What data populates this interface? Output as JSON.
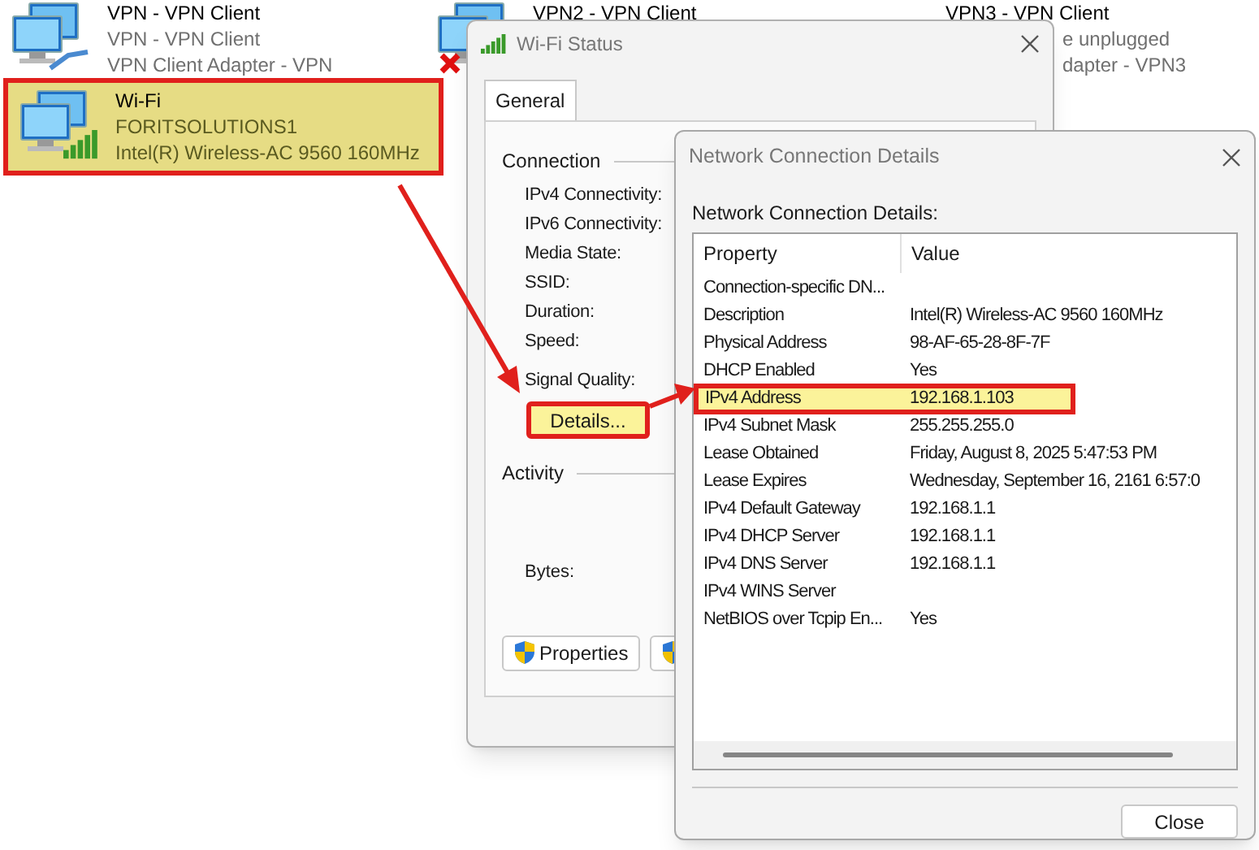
{
  "explorer_items": [
    {
      "name": "VPN - VPN Client",
      "line_2": "VPN - VPN Client",
      "line_3": "VPN Client Adapter - VPN",
      "kind": "vpn",
      "selected": false
    },
    {
      "name": "VPN2 - VPN Client",
      "kind": "vpn",
      "disconnected": true,
      "selected": false
    },
    {
      "name": "VPN3 - VPN Client",
      "line_2": "e unplugged",
      "line_3": "dapter - VPN3",
      "kind": "covered",
      "selected": false
    },
    {
      "name": "Wi-Fi",
      "line_2": "FORITSOLUTIONS1",
      "line_3": "Intel(R) Wireless-AC 9560 160MHz",
      "kind": "wifi",
      "selected": true
    }
  ],
  "status_window": {
    "title": "Wi-Fi Status",
    "tabs": [
      {
        "label": "General",
        "selected": true
      }
    ],
    "connection": {
      "title": "Connection",
      "fields": [
        "IPv4 Connectivity:",
        "IPv6 Connectivity:",
        "Media State:",
        "SSID:",
        "Duration:",
        "Speed:"
      ]
    },
    "signal_quality_label": "Signal Quality:",
    "details_button": {
      "label": "Details...",
      "highlighted": true
    },
    "activity": {
      "title": "Activity",
      "bytes_label": "Bytes:"
    },
    "properties_button": {
      "label": "Properties"
    }
  },
  "details_window": {
    "title": "Network Connection Details",
    "caption": "Network Connection Details:",
    "columns": [
      "Property",
      "Value"
    ],
    "rows": [
      {
        "property": "Connection-specific DN...",
        "value": "",
        "selected": false
      },
      {
        "property": "Description",
        "value": "Intel(R) Wireless-AC 9560 160MHz",
        "selected": false
      },
      {
        "property": "Physical Address",
        "value": "98-AF-65-28-8F-7F",
        "selected": false
      },
      {
        "property": "DHCP Enabled",
        "value": "Yes",
        "selected": false
      },
      {
        "property": "IPv4 Address",
        "value": "192.168.1.103",
        "selected": true
      },
      {
        "property": "IPv4 Subnet Mask",
        "value": "255.255.255.0",
        "selected": false
      },
      {
        "property": "Lease Obtained",
        "value": "Friday, August 8, 2025 5:47:53 PM",
        "selected": false
      },
      {
        "property": "Lease Expires",
        "value": "Wednesday, September 16, 2161 6:57:0",
        "selected": false
      },
      {
        "property": "IPv4 Default Gateway",
        "value": "192.168.1.1",
        "selected": false
      },
      {
        "property": "IPv4 DHCP Server",
        "value": "192.168.1.1",
        "selected": false
      },
      {
        "property": "IPv4 DNS Server",
        "value": "192.168.1.1",
        "selected": false
      },
      {
        "property": "IPv4 WINS Server",
        "value": "",
        "selected": false
      },
      {
        "property": "NetBIOS over Tcpip En...",
        "value": "Yes",
        "selected": false
      }
    ],
    "close_button": "Close"
  }
}
